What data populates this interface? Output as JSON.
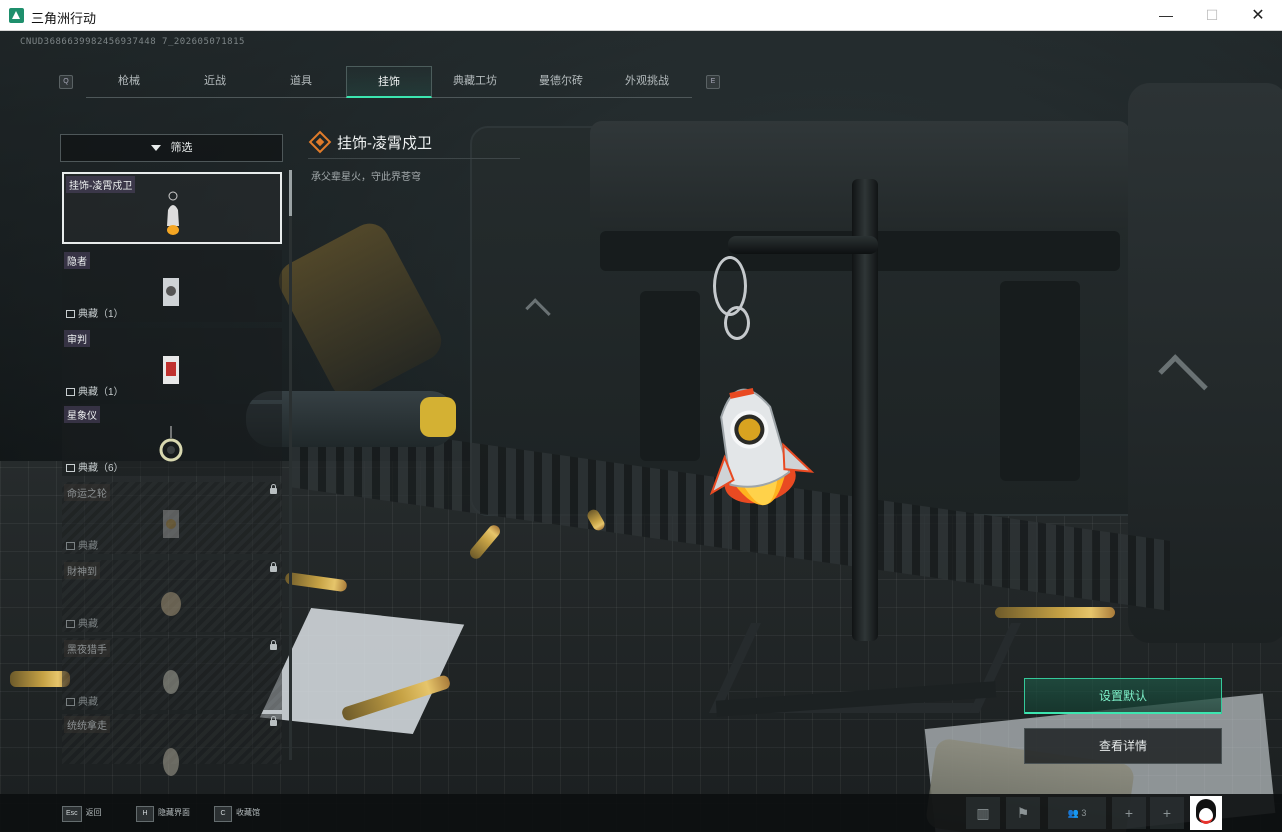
{
  "window": {
    "title": "三角洲行动",
    "build_id": "CNUD3686639982456937448 7_202605071815"
  },
  "tabs": {
    "left_key": "Q",
    "right_key": "E",
    "items": [
      {
        "label": "枪械"
      },
      {
        "label": "近战"
      },
      {
        "label": "道具"
      },
      {
        "label": "挂饰",
        "active": true
      },
      {
        "label": "典藏工坊"
      },
      {
        "label": "曼德尔砖"
      },
      {
        "label": "外观挑战"
      }
    ]
  },
  "filter": {
    "label": "筛选"
  },
  "list": [
    {
      "name": "挂饰-凌霄戍卫",
      "count": "",
      "selected": true,
      "locked": false
    },
    {
      "name": "隐者",
      "count": "典藏（1）",
      "locked": false
    },
    {
      "name": "审判",
      "count": "典藏（1）",
      "locked": false
    },
    {
      "name": "星象仪",
      "count": "典藏（6）",
      "locked": false
    },
    {
      "name": "命运之轮",
      "count": "典藏",
      "locked": true
    },
    {
      "name": "財神到",
      "count": "典藏",
      "locked": true
    },
    {
      "name": "黑夜猎手",
      "count": "典藏",
      "locked": true
    },
    {
      "name": "统统拿走",
      "count": "",
      "locked": true
    }
  ],
  "detail": {
    "title": "挂饰-凌霄戍卫",
    "subtitle": "承父辈星火，守此界苍穹"
  },
  "actions": {
    "set_default": "设置默认",
    "view_details": "查看详情"
  },
  "bottom_hints": [
    {
      "key": "Esc",
      "label": "返回"
    },
    {
      "key": "H",
      "label": "隐藏界面"
    },
    {
      "key": "C",
      "label": "收藏馆"
    }
  ],
  "tray": {
    "party_count": "3"
  },
  "colors": {
    "accent": "#3ce6b0",
    "title_icon": "#e07b2a"
  }
}
